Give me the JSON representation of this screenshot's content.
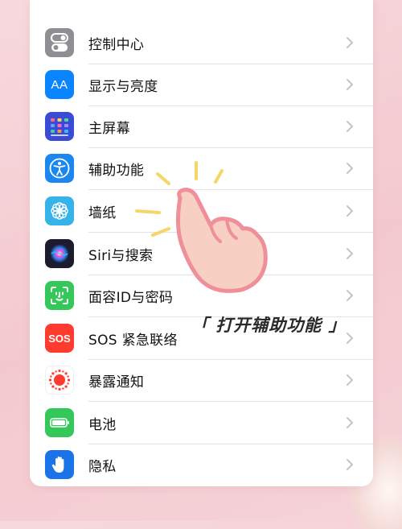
{
  "settings": {
    "items": [
      {
        "label": "控制中心",
        "icon": "control-center-icon",
        "color": "#8e8e93"
      },
      {
        "label": "显示与亮度",
        "icon": "display-brightness-icon",
        "color": "#0a84ff"
      },
      {
        "label": "主屏幕",
        "icon": "home-screen-icon",
        "color": "#3b4bd8"
      },
      {
        "label": "辅助功能",
        "icon": "accessibility-icon",
        "color": "#1a86f0"
      },
      {
        "label": "墙纸",
        "icon": "wallpaper-icon",
        "color": "#36b3e8"
      },
      {
        "label": "Siri与搜索",
        "icon": "siri-icon",
        "color": "#1c1c2e"
      },
      {
        "label": "面容ID与密码",
        "icon": "face-id-icon",
        "color": "#34c759"
      },
      {
        "label": "SOS 紧急联络",
        "icon": "sos-icon",
        "color": "#ff3b30"
      },
      {
        "label": "暴露通知",
        "icon": "exposure-notification-icon",
        "color": "#ffffff"
      },
      {
        "label": "电池",
        "icon": "battery-icon",
        "color": "#34c759"
      },
      {
        "label": "隐私",
        "icon": "privacy-hand-icon",
        "color": "#1a73e8"
      }
    ],
    "sos_text": "SOS",
    "aa_text": "AA"
  },
  "annotation": {
    "caption": "「 打开辅助功能 」",
    "hand_color": "#f6c9bd",
    "hand_outline": "#ef8f99",
    "sparkle_color": "#f5d66a"
  }
}
